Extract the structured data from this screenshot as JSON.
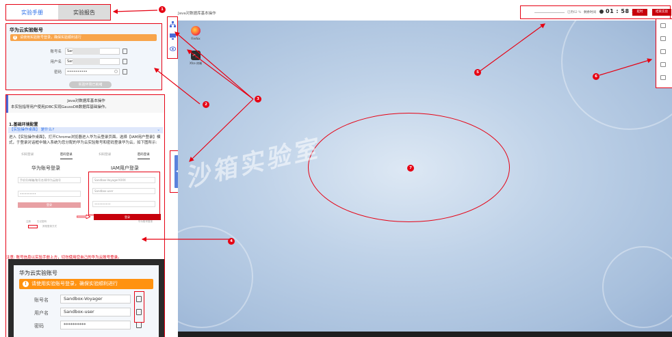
{
  "tabs": {
    "manual": "实验手册",
    "report": "实验报告"
  },
  "account": {
    "title": "华为云实验账号",
    "warning": "请使用实验账号登录，确保实验顺利进行",
    "fields": [
      {
        "label": "账号名",
        "value": "Sand"
      },
      {
        "label": "用户名",
        "value": "Sand"
      },
      {
        "label": "密码",
        "value": "••••••••••"
      }
    ],
    "ready_button": "实验环境已就绪"
  },
  "manual": {
    "title": "Java对数据库基本操作",
    "description": "本实验指导用户使用JDBC实现GaussDB数据库基础操作。",
    "section": "1.基础环境配置",
    "collapse": "【实验操作桌面】 是什么?",
    "paragraph": "进入【实验操作桌面】，打开Chrome浏览器进入华为云登录页面。选择【IAM用户登录】模式，于登录对话框中输入系统为您分配的华为云实验账号和密码登录华为云，如下图所示:",
    "login_tabs": [
      "扫码登录",
      "密码登录",
      "扫码登录",
      "密码登录"
    ],
    "login_left_title": "华为账号登录",
    "login_right_title": "IAM用户登录",
    "login_left_fields": [
      "手机号/邮箱/账号名/原华为云账号",
      "••••••••••"
    ],
    "login_right_fields": [
      "Sandbox-VoyagerXXXX",
      "Sandbox-user",
      "••••••••••"
    ],
    "login_button": "登录",
    "login_links": [
      "注册",
      "忘记密码",
      "其他登录方式",
      "华为账号登录"
    ],
    "note": "注意: 账号信息以实验手册上方，切勿使用您自己的华为云账号登录。",
    "card": {
      "title": "华为云实验账号",
      "warning": "请使用实验账号登录，确保实验顺利进行",
      "fields": [
        {
          "label": "账号名",
          "value": "Sandbox-Voyager"
        },
        {
          "label": "用户名",
          "value": "Sandbox-user"
        },
        {
          "label": "密码",
          "value": "**********"
        }
      ]
    }
  },
  "topbar": {
    "title": "Java对数据库基本操作",
    "used_pct": "已用62 %",
    "remaining_label": "剩余时间",
    "remaining_time": "01 : 58 : 28",
    "extend_button": "延时",
    "end_button": "结束实验"
  },
  "desktop": {
    "icons": [
      {
        "caption": "Firefox"
      },
      {
        "caption": "Xfce 终端"
      }
    ],
    "watermark": "沙箱实验室"
  },
  "badges": [
    "1",
    "2",
    "3",
    "4",
    "5",
    "6",
    "7"
  ],
  "colors": {
    "accent": "#e60012",
    "brand_blue": "#2a6ee8",
    "warning": "#ff9210"
  }
}
